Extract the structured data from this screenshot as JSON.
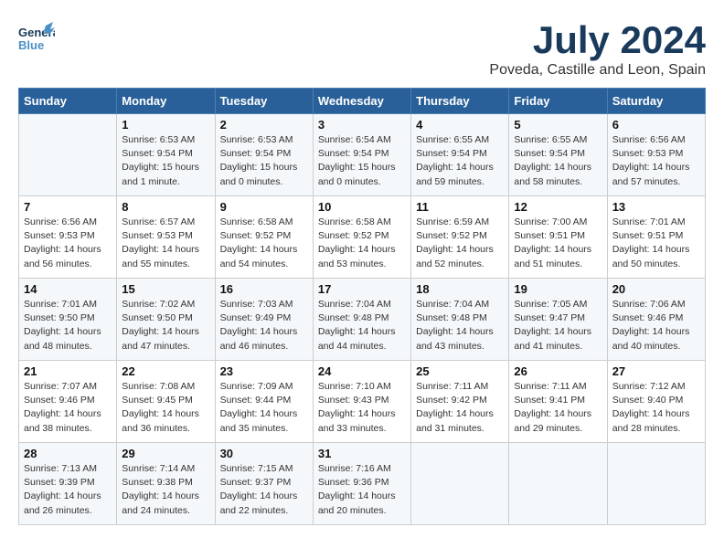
{
  "header": {
    "logo_top": "General",
    "logo_bottom": "Blue",
    "month_title": "July 2024",
    "location": "Poveda, Castille and Leon, Spain"
  },
  "calendar": {
    "days_of_week": [
      "Sunday",
      "Monday",
      "Tuesday",
      "Wednesday",
      "Thursday",
      "Friday",
      "Saturday"
    ],
    "weeks": [
      [
        {
          "day": "",
          "info": ""
        },
        {
          "day": "1",
          "info": "Sunrise: 6:53 AM\nSunset: 9:54 PM\nDaylight: 15 hours\nand 1 minute."
        },
        {
          "day": "2",
          "info": "Sunrise: 6:53 AM\nSunset: 9:54 PM\nDaylight: 15 hours\nand 0 minutes."
        },
        {
          "day": "3",
          "info": "Sunrise: 6:54 AM\nSunset: 9:54 PM\nDaylight: 15 hours\nand 0 minutes."
        },
        {
          "day": "4",
          "info": "Sunrise: 6:55 AM\nSunset: 9:54 PM\nDaylight: 14 hours\nand 59 minutes."
        },
        {
          "day": "5",
          "info": "Sunrise: 6:55 AM\nSunset: 9:54 PM\nDaylight: 14 hours\nand 58 minutes."
        },
        {
          "day": "6",
          "info": "Sunrise: 6:56 AM\nSunset: 9:53 PM\nDaylight: 14 hours\nand 57 minutes."
        }
      ],
      [
        {
          "day": "7",
          "info": "Sunrise: 6:56 AM\nSunset: 9:53 PM\nDaylight: 14 hours\nand 56 minutes."
        },
        {
          "day": "8",
          "info": "Sunrise: 6:57 AM\nSunset: 9:53 PM\nDaylight: 14 hours\nand 55 minutes."
        },
        {
          "day": "9",
          "info": "Sunrise: 6:58 AM\nSunset: 9:52 PM\nDaylight: 14 hours\nand 54 minutes."
        },
        {
          "day": "10",
          "info": "Sunrise: 6:58 AM\nSunset: 9:52 PM\nDaylight: 14 hours\nand 53 minutes."
        },
        {
          "day": "11",
          "info": "Sunrise: 6:59 AM\nSunset: 9:52 PM\nDaylight: 14 hours\nand 52 minutes."
        },
        {
          "day": "12",
          "info": "Sunrise: 7:00 AM\nSunset: 9:51 PM\nDaylight: 14 hours\nand 51 minutes."
        },
        {
          "day": "13",
          "info": "Sunrise: 7:01 AM\nSunset: 9:51 PM\nDaylight: 14 hours\nand 50 minutes."
        }
      ],
      [
        {
          "day": "14",
          "info": "Sunrise: 7:01 AM\nSunset: 9:50 PM\nDaylight: 14 hours\nand 48 minutes."
        },
        {
          "day": "15",
          "info": "Sunrise: 7:02 AM\nSunset: 9:50 PM\nDaylight: 14 hours\nand 47 minutes."
        },
        {
          "day": "16",
          "info": "Sunrise: 7:03 AM\nSunset: 9:49 PM\nDaylight: 14 hours\nand 46 minutes."
        },
        {
          "day": "17",
          "info": "Sunrise: 7:04 AM\nSunset: 9:48 PM\nDaylight: 14 hours\nand 44 minutes."
        },
        {
          "day": "18",
          "info": "Sunrise: 7:04 AM\nSunset: 9:48 PM\nDaylight: 14 hours\nand 43 minutes."
        },
        {
          "day": "19",
          "info": "Sunrise: 7:05 AM\nSunset: 9:47 PM\nDaylight: 14 hours\nand 41 minutes."
        },
        {
          "day": "20",
          "info": "Sunrise: 7:06 AM\nSunset: 9:46 PM\nDaylight: 14 hours\nand 40 minutes."
        }
      ],
      [
        {
          "day": "21",
          "info": "Sunrise: 7:07 AM\nSunset: 9:46 PM\nDaylight: 14 hours\nand 38 minutes."
        },
        {
          "day": "22",
          "info": "Sunrise: 7:08 AM\nSunset: 9:45 PM\nDaylight: 14 hours\nand 36 minutes."
        },
        {
          "day": "23",
          "info": "Sunrise: 7:09 AM\nSunset: 9:44 PM\nDaylight: 14 hours\nand 35 minutes."
        },
        {
          "day": "24",
          "info": "Sunrise: 7:10 AM\nSunset: 9:43 PM\nDaylight: 14 hours\nand 33 minutes."
        },
        {
          "day": "25",
          "info": "Sunrise: 7:11 AM\nSunset: 9:42 PM\nDaylight: 14 hours\nand 31 minutes."
        },
        {
          "day": "26",
          "info": "Sunrise: 7:11 AM\nSunset: 9:41 PM\nDaylight: 14 hours\nand 29 minutes."
        },
        {
          "day": "27",
          "info": "Sunrise: 7:12 AM\nSunset: 9:40 PM\nDaylight: 14 hours\nand 28 minutes."
        }
      ],
      [
        {
          "day": "28",
          "info": "Sunrise: 7:13 AM\nSunset: 9:39 PM\nDaylight: 14 hours\nand 26 minutes."
        },
        {
          "day": "29",
          "info": "Sunrise: 7:14 AM\nSunset: 9:38 PM\nDaylight: 14 hours\nand 24 minutes."
        },
        {
          "day": "30",
          "info": "Sunrise: 7:15 AM\nSunset: 9:37 PM\nDaylight: 14 hours\nand 22 minutes."
        },
        {
          "day": "31",
          "info": "Sunrise: 7:16 AM\nSunset: 9:36 PM\nDaylight: 14 hours\nand 20 minutes."
        },
        {
          "day": "",
          "info": ""
        },
        {
          "day": "",
          "info": ""
        },
        {
          "day": "",
          "info": ""
        }
      ]
    ]
  }
}
